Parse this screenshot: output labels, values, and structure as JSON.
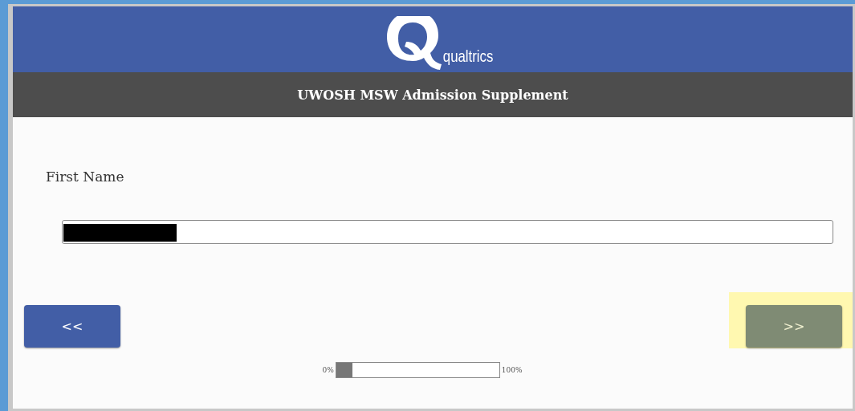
{
  "header": {
    "logo_text": "qualtrics"
  },
  "survey_title": "UWOSH MSW Admission Supplement",
  "question": {
    "label": "First Name",
    "answer_redacted": true
  },
  "buttons": [
    {
      "label": "<<",
      "kind": "back",
      "highlighted": false
    },
    {
      "label": ">>",
      "kind": "next",
      "highlighted": true
    }
  ],
  "progress": {
    "start_label": "0%",
    "end_label": "100%",
    "level": 0.1
  }
}
